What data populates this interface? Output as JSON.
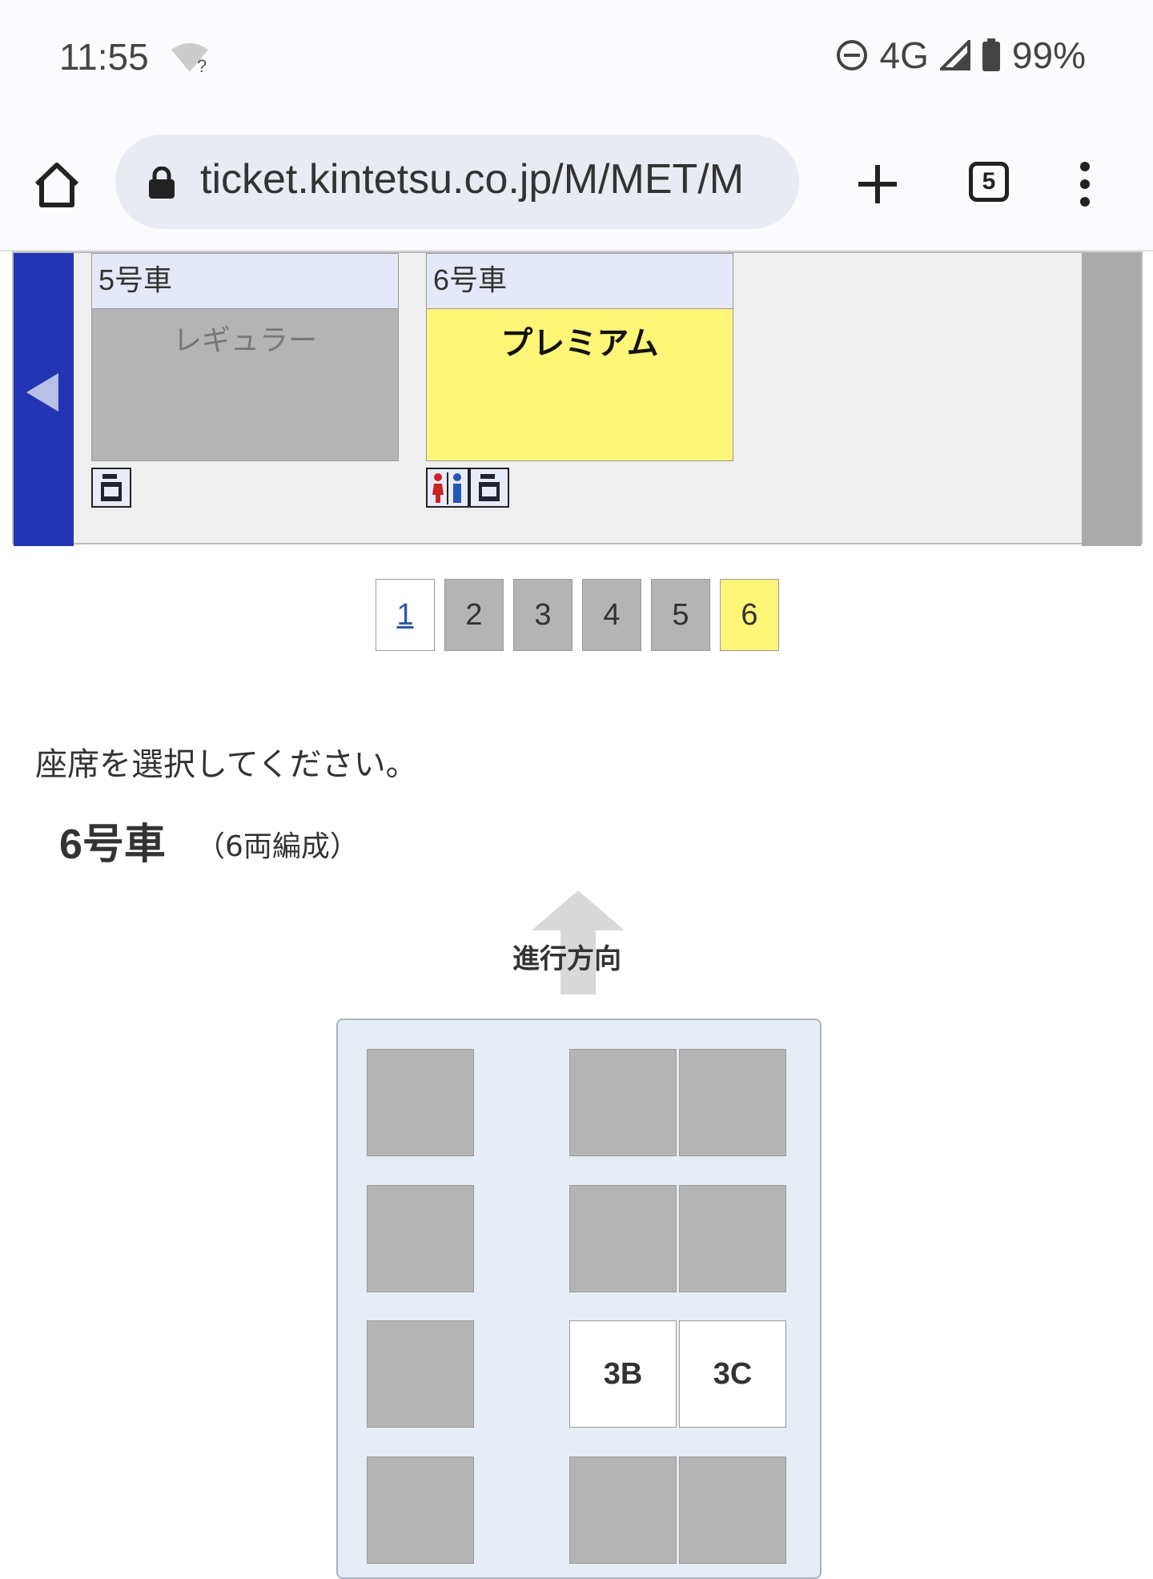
{
  "status_bar": {
    "time": "11:55",
    "network": "4G",
    "battery": "99%",
    "icons": [
      "wifi-unknown-icon",
      "do-not-disturb-icon",
      "signal-icon",
      "battery-icon"
    ]
  },
  "browser": {
    "url": "ticket.kintetsu.co.jp/M/MET/M",
    "tab_count": "5",
    "icons": [
      "home-icon",
      "lock-icon",
      "plus-icon",
      "tabs-icon",
      "menu-icon"
    ]
  },
  "cars": [
    {
      "label": "5号車",
      "class_name": "レギュラー",
      "icons": [
        "luggage-icon"
      ]
    },
    {
      "label": "6号車",
      "class_name": "プレミアム",
      "icons": [
        "restroom-icon",
        "luggage-icon"
      ]
    }
  ],
  "pager": [
    "1",
    "2",
    "3",
    "4",
    "5",
    "6"
  ],
  "instruction": "座席を選択してください。",
  "car_title": "6号車",
  "car_subtitle": "（6両編成）",
  "direction_label": "進行方向",
  "seats": {
    "available": [
      "3B",
      "3C"
    ]
  },
  "colors": {
    "nav_blue": "#2236b5",
    "premium_yellow": "#fff576",
    "unavailable_gray": "#b4b4b4"
  }
}
